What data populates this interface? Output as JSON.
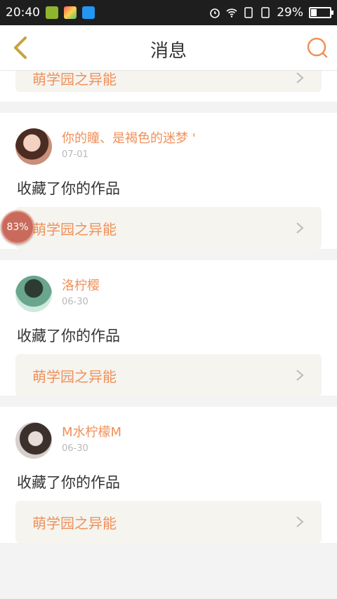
{
  "status_bar": {
    "time": "20:40",
    "battery_percent": "29%",
    "battery_level": 0.29,
    "icons": [
      "app-icon-1",
      "app-icon-2",
      "screenshot-app-icon",
      "alarm-icon",
      "wifi-icon",
      "sim1-icon",
      "sim2-icon",
      "battery-icon"
    ]
  },
  "header": {
    "title": "消息",
    "back_icon": "chevron-left-icon",
    "search_icon": "search-icon"
  },
  "partial_item": {
    "work_title": "萌学园之异能"
  },
  "items": [
    {
      "user": "你的瞳、是褐色的迷梦 '",
      "date": "07-01",
      "action": "收藏了你的作品",
      "work_title": "萌学园之异能"
    },
    {
      "user": "洛柠樱",
      "date": "06-30",
      "action": "收藏了你的作品",
      "work_title": "萌学园之异能"
    },
    {
      "user": "M水柠檬M",
      "date": "06-30",
      "action": "收藏了你的作品",
      "work_title": "萌学园之异能"
    }
  ],
  "floating_badge": {
    "label": "83%"
  },
  "colors": {
    "accent": "#f0905a",
    "back": "#c9a23a",
    "text": "#333333"
  }
}
